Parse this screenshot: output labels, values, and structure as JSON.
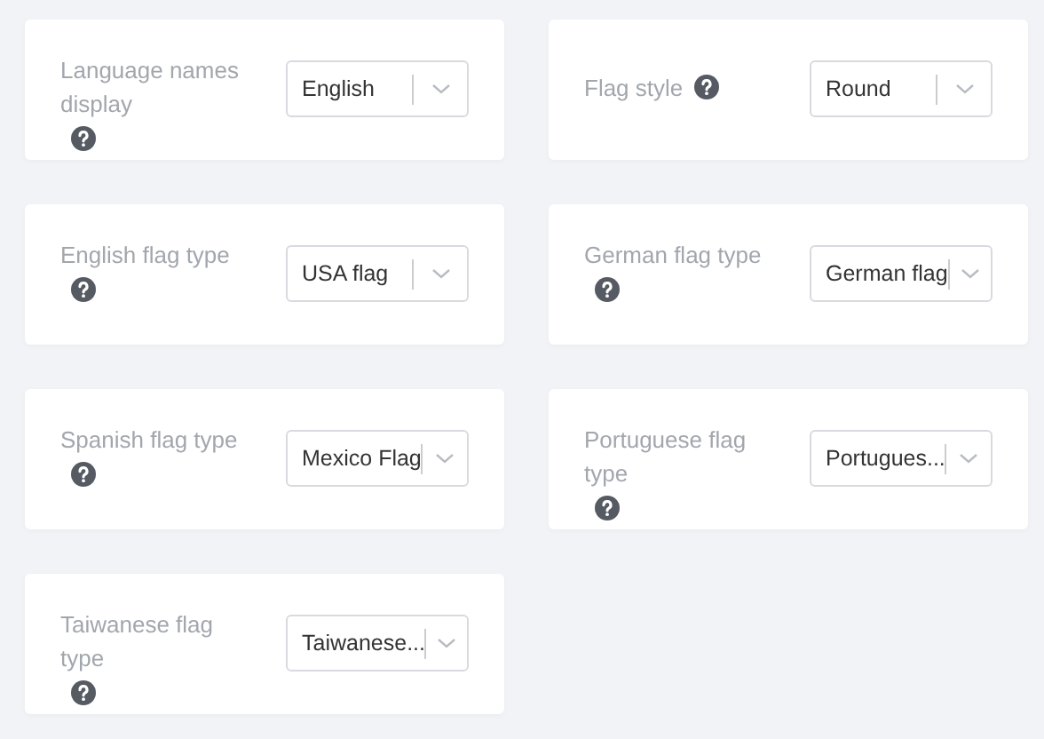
{
  "settings": [
    {
      "label": "Language names display",
      "value": "English"
    },
    {
      "label": "Flag style",
      "value": "Round"
    },
    {
      "label": "English flag type",
      "value": "USA flag"
    },
    {
      "label": "German flag type",
      "value": "German flag"
    },
    {
      "label": "Spanish flag type",
      "value": "Mexico Flag"
    },
    {
      "label": "Portuguese flag type",
      "value": "Portugues..."
    },
    {
      "label": "Taiwanese flag type",
      "value": "Taiwanese..."
    }
  ]
}
